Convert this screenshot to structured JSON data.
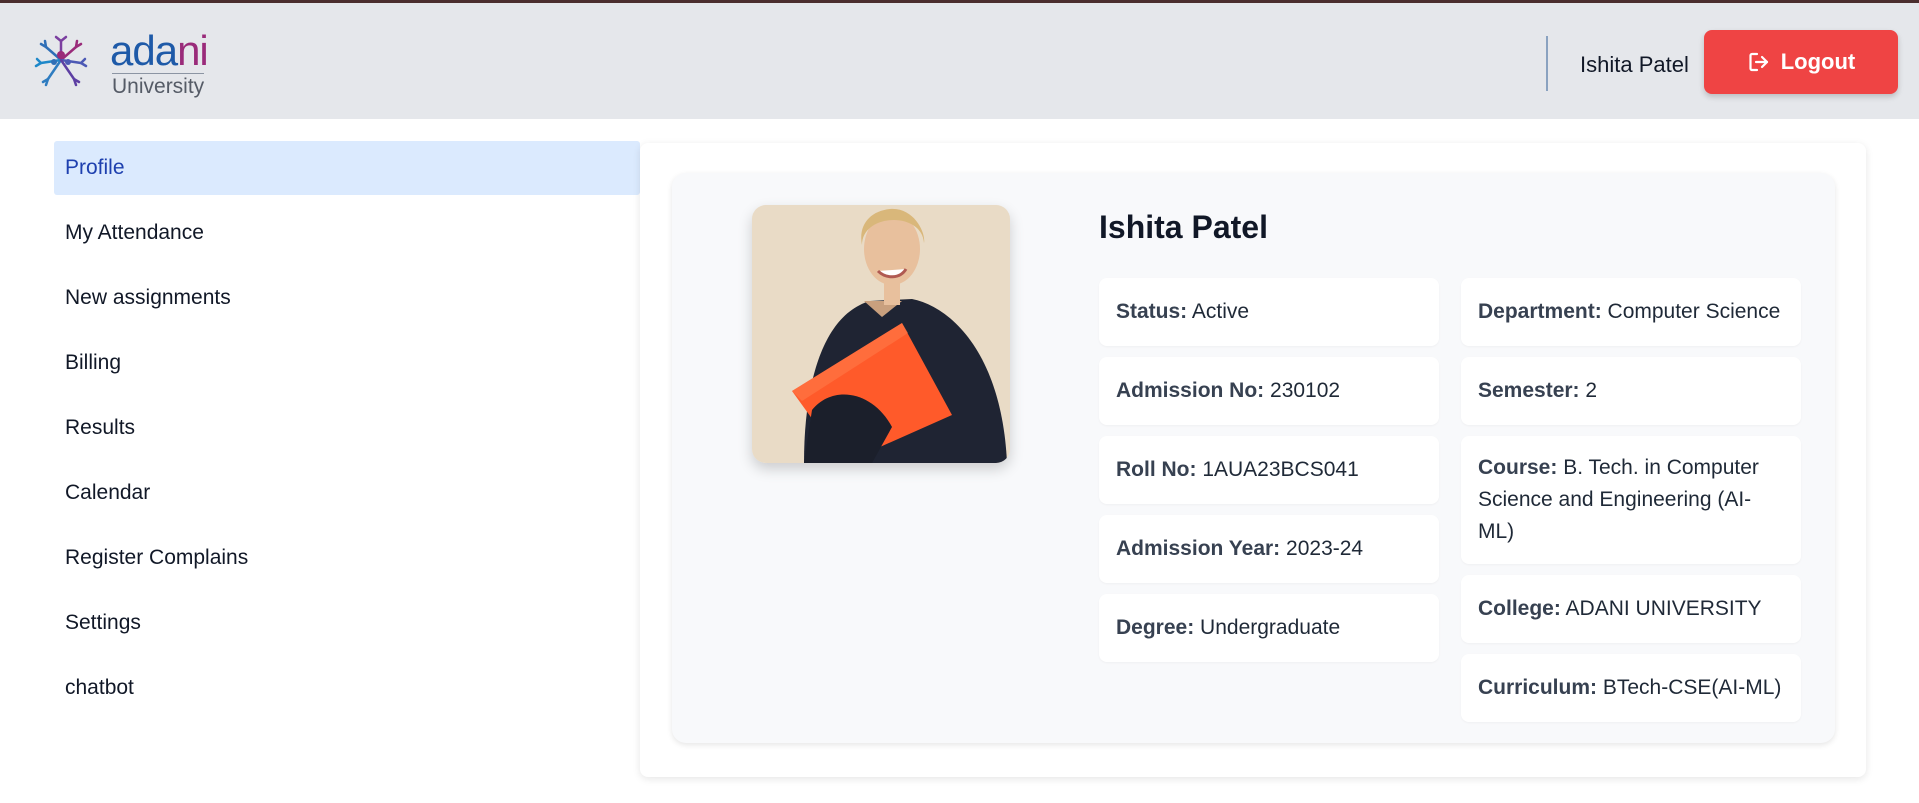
{
  "header": {
    "logo_word_1": "ada",
    "logo_word_2": "ni",
    "logo_subtitle": "University",
    "user_name": "Ishita Patel",
    "logout_label": "Logout"
  },
  "sidebar": {
    "items": [
      {
        "label": "Profile",
        "active": true
      },
      {
        "label": "My Attendance"
      },
      {
        "label": "New assignments"
      },
      {
        "label": "Billing"
      },
      {
        "label": "Results"
      },
      {
        "label": "Calendar"
      },
      {
        "label": "Register Complains"
      },
      {
        "label": "Settings"
      },
      {
        "label": "chatbot"
      }
    ]
  },
  "profile": {
    "name": "Ishita Patel",
    "left_fields": [
      {
        "key": "Status:",
        "value": "Active"
      },
      {
        "key": "Admission No:",
        "value": "230102"
      },
      {
        "key": "Roll No:",
        "value": "1AUA23BCS041"
      },
      {
        "key": "Admission Year:",
        "value": "2023-24"
      },
      {
        "key": "Degree:",
        "value": "Undergraduate"
      }
    ],
    "right_fields": [
      {
        "key": "Department:",
        "value": "Computer Science"
      },
      {
        "key": "Semester:",
        "value": "2"
      },
      {
        "key": "Course:",
        "value": "B. Tech. in Computer Science and Engineering (AI-ML)"
      },
      {
        "key": "College:",
        "value": "ADANI UNIVERSITY"
      },
      {
        "key": "Curriculum:",
        "value": "BTech-CSE(AI-ML)"
      }
    ]
  },
  "colors": {
    "logout_bg": "#ef4444",
    "active_nav_bg": "#dbeafe",
    "header_bg": "#e5e7eb"
  },
  "icons": {
    "logo": "adani-tree-logo-icon",
    "logout": "logout-icon"
  }
}
